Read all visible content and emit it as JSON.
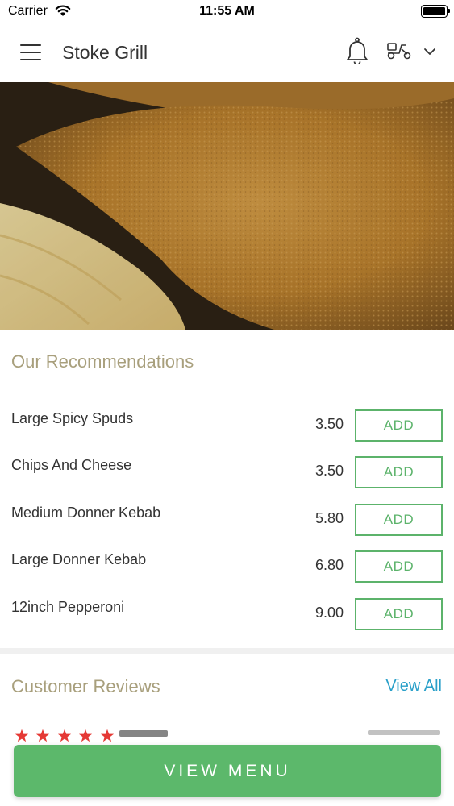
{
  "status_bar": {
    "carrier": "Carrier",
    "time": "11:55 AM"
  },
  "header": {
    "title": "Stoke Grill",
    "icons": [
      "menu-icon",
      "bell-icon",
      "scooter-icon",
      "chevron-down-icon"
    ]
  },
  "recommendations": {
    "title": "Our Recommendations",
    "add_label": "ADD",
    "items": [
      {
        "name": "Large Spicy Spuds",
        "price": "3.50"
      },
      {
        "name": "Chips And Cheese",
        "price": "3.50"
      },
      {
        "name": "Medium Donner Kebab",
        "price": "5.80"
      },
      {
        "name": "Large Donner Kebab",
        "price": "6.80"
      },
      {
        "name": "12inch Pepperoni",
        "price": "9.00"
      }
    ]
  },
  "reviews": {
    "title": "Customer Reviews",
    "view_all": "View All",
    "rating": 5
  },
  "footer": {
    "view_menu": "VIEW MENU"
  },
  "colors": {
    "accent_green": "#5cb86b",
    "title_gold": "#a89f7c",
    "link_blue": "#2aa0c9",
    "star_red": "#e53935"
  }
}
